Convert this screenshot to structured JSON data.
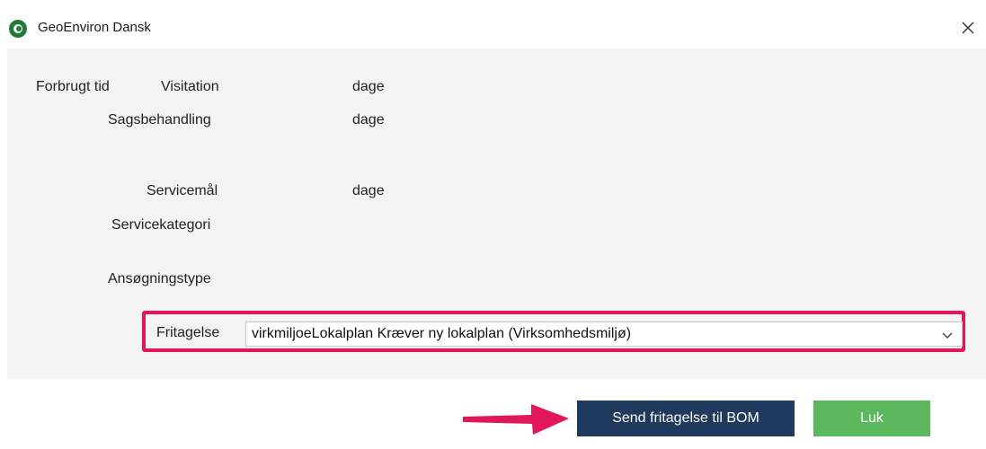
{
  "window": {
    "title": "GeoEnviron Dansk",
    "close_icon": "close-icon"
  },
  "form": {
    "forbrugt_tid_label": "Forbrugt tid",
    "visitation_label": "Visitation",
    "visitation_unit": "dage",
    "sagsbehandling_label": "Sagsbehandling",
    "sagsbehandling_unit": "dage",
    "servicemaal_label": "Servicemål",
    "servicemaal_unit": "dage",
    "servicekategori_label": "Servicekategori",
    "ansoegningstype_label": "Ansøgningstype",
    "fritagelse_label": "Fritagelse",
    "fritagelse_value": "virkmiljoeLokalplan Kræver ny lokalplan (Virksomhedsmiljø)"
  },
  "buttons": {
    "send_label": "Send fritagelse til BOM",
    "luk_label": "Luk"
  },
  "colors": {
    "highlight": "#e2165a",
    "send_button": "#1f3a5c",
    "luk_button": "#5cb85c",
    "app_icon": "#1f7a3a"
  }
}
